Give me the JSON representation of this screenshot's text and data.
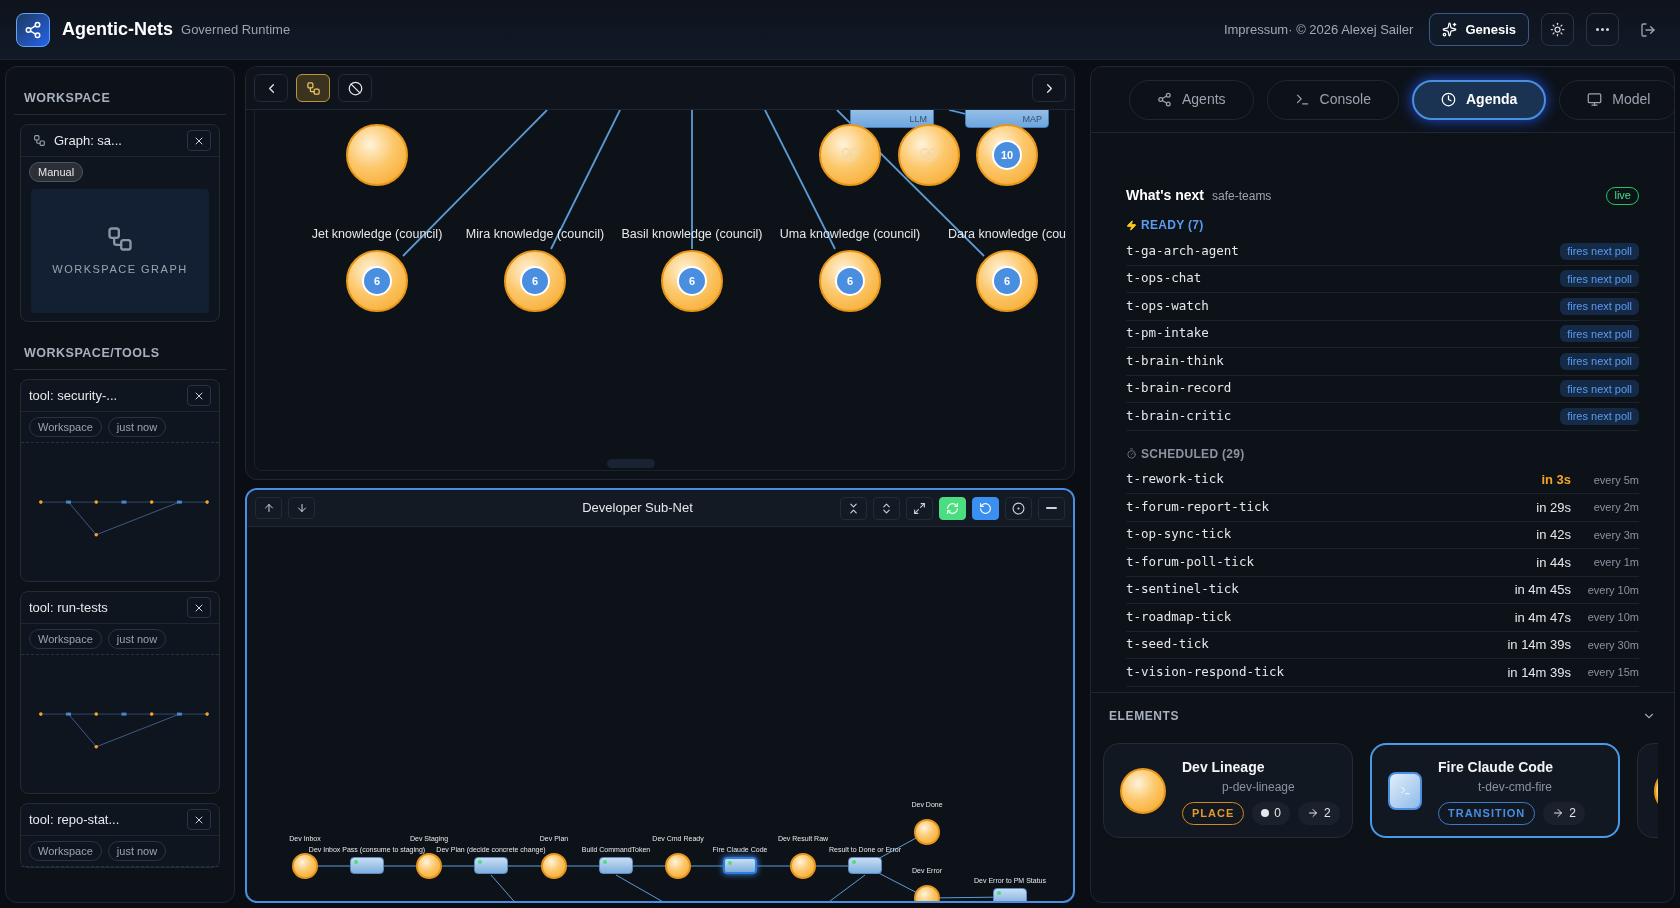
{
  "header": {
    "app_name": "Agentic-Nets",
    "subtitle": "Governed Runtime",
    "credit": "Impressum· © 2026 Alexej Sailer",
    "genesis_label": "Genesis"
  },
  "sidebar": {
    "sections": [
      {
        "title": "WORKSPACE",
        "cards": [
          {
            "kind": "graph",
            "title": "Graph: sa...",
            "tags": [
              "Manual"
            ],
            "preview_label": "WORKSPACE GRAPH"
          }
        ]
      },
      {
        "title": "WORKSPACE/TOOLS",
        "cards": [
          {
            "kind": "tool",
            "title": "tool: security-...",
            "tags": [
              "Workspace",
              "just now"
            ],
            "preview": true
          },
          {
            "kind": "tool",
            "title": "tool: run-tests",
            "tags": [
              "Workspace",
              "just now"
            ],
            "preview": true
          },
          {
            "kind": "tool",
            "title": "tool: repo-stat...",
            "tags": [
              "Workspace",
              "just now"
            ],
            "preview": false
          }
        ]
      }
    ]
  },
  "canvas": {
    "view_modes": [
      {
        "kind": "graph",
        "selected": true
      },
      {
        "kind": "blocked",
        "selected": false
      }
    ],
    "places": [
      {
        "kind": "plain"
      },
      {
        "kind": "linked"
      },
      {
        "kind": "linked"
      },
      {
        "kind": "plain",
        "tokens": "10"
      },
      {
        "kind": "plain",
        "label": "Jet knowledge (council)",
        "tokens": "6"
      },
      {
        "kind": "plain",
        "label": "Mira knowledge (council)",
        "tokens": "6"
      },
      {
        "kind": "plain",
        "label": "Basil knowledge (council)",
        "tokens": "6"
      },
      {
        "kind": "plain",
        "label": "Uma knowledge (council)",
        "tokens": "6"
      },
      {
        "kind": "plain",
        "label": "Dara knowledge (cou",
        "tokens": "6"
      }
    ],
    "transitions": [
      {
        "badge": "LLM"
      },
      {
        "badge": "MAP"
      }
    ]
  },
  "subnet": {
    "title": "Developer Sub-Net",
    "tools": [
      {
        "kind": "collapse",
        "on": false
      },
      {
        "kind": "expand",
        "on": false
      },
      {
        "kind": "fullscreen",
        "on": false
      },
      {
        "kind": "refresh",
        "on": true
      },
      {
        "kind": "reset",
        "on": true
      },
      {
        "kind": "target",
        "on": false
      },
      {
        "kind": "minimize",
        "on": false
      }
    ],
    "nodes": [
      {
        "kind": "place",
        "label": "Dev Inbox",
        "selected": false
      },
      {
        "kind": "transition",
        "label": "Dev Inbox Pass (consume to staging)",
        "selected": false
      },
      {
        "kind": "place",
        "label": "Dev Staging",
        "selected": false
      },
      {
        "kind": "transition",
        "label": "Dev Plan (decide concrete change)",
        "selected": false
      },
      {
        "kind": "place",
        "label": "Dev Plan",
        "selected": false
      },
      {
        "kind": "transition",
        "label": "Build CommandToken",
        "selected": false
      },
      {
        "kind": "place",
        "label": "Dev Cmd Ready",
        "selected": false
      },
      {
        "kind": "transition",
        "label": "Fire Claude Code",
        "selected": true
      },
      {
        "kind": "place",
        "label": "Dev Result Raw",
        "selected": false
      },
      {
        "kind": "transition",
        "label": "Result to Done or Error",
        "selected": false
      },
      {
        "kind": "place",
        "label": "Dev Done",
        "selected": false
      },
      {
        "kind": "place",
        "label": "Dev Error",
        "selected": false
      },
      {
        "kind": "transition",
        "label": "Dev Error to PM Status",
        "selected": false
      }
    ]
  },
  "tabs": [
    {
      "kind": "agents",
      "label": "Agents",
      "selected": false
    },
    {
      "kind": "console",
      "label": "Console",
      "selected": false
    },
    {
      "kind": "agenda",
      "label": "Agenda",
      "selected": true
    },
    {
      "kind": "model",
      "label": "Model",
      "selected": false
    }
  ],
  "agenda": {
    "title": "What's next",
    "scope": "safe-teams",
    "status": "live",
    "ready": {
      "heading": "READY (7)",
      "items": [
        {
          "name": "t-ga-arch-agent",
          "note": "fires next poll"
        },
        {
          "name": "t-ops-chat",
          "note": "fires next poll"
        },
        {
          "name": "t-ops-watch",
          "note": "fires next poll"
        },
        {
          "name": "t-pm-intake",
          "note": "fires next poll"
        },
        {
          "name": "t-brain-think",
          "note": "fires next poll"
        },
        {
          "name": "t-brain-record",
          "note": "fires next poll"
        },
        {
          "name": "t-brain-critic",
          "note": "fires next poll"
        }
      ]
    },
    "scheduled": {
      "heading": "SCHEDULED (29)",
      "items": [
        {
          "name": "t-rework-tick",
          "eta": "in 3s",
          "every": "every 5m",
          "imminent": true
        },
        {
          "name": "t-forum-report-tick",
          "eta": "in 29s",
          "every": "every 2m",
          "imminent": false
        },
        {
          "name": "t-op-sync-tick",
          "eta": "in 42s",
          "every": "every 3m",
          "imminent": false
        },
        {
          "name": "t-forum-poll-tick",
          "eta": "in 44s",
          "every": "every 1m",
          "imminent": false
        },
        {
          "name": "t-sentinel-tick",
          "eta": "in 4m 45s",
          "every": "every 10m",
          "imminent": false
        },
        {
          "name": "t-roadmap-tick",
          "eta": "in 4m 47s",
          "every": "every 10m",
          "imminent": false
        },
        {
          "name": "t-seed-tick",
          "eta": "in 14m 39s",
          "every": "every 30m",
          "imminent": false
        },
        {
          "name": "t-vision-respond-tick",
          "eta": "in 14m 39s",
          "every": "every 15m",
          "imminent": false
        }
      ]
    }
  },
  "elements": {
    "heading": "ELEMENTS",
    "expanded": true,
    "cards": [
      {
        "kind": "place",
        "title": "Dev Lineage",
        "ident": "p-dev-lineage",
        "type_label": "PLACE",
        "tokens": "0",
        "arcs": "2",
        "selected": false
      },
      {
        "kind": "transition",
        "title": "Fire Claude Code",
        "ident": "t-dev-cmd-fire",
        "type_label": "TRANSITION",
        "arcs": "2",
        "selected": true
      },
      {
        "kind": "place",
        "selected": false
      }
    ]
  }
}
